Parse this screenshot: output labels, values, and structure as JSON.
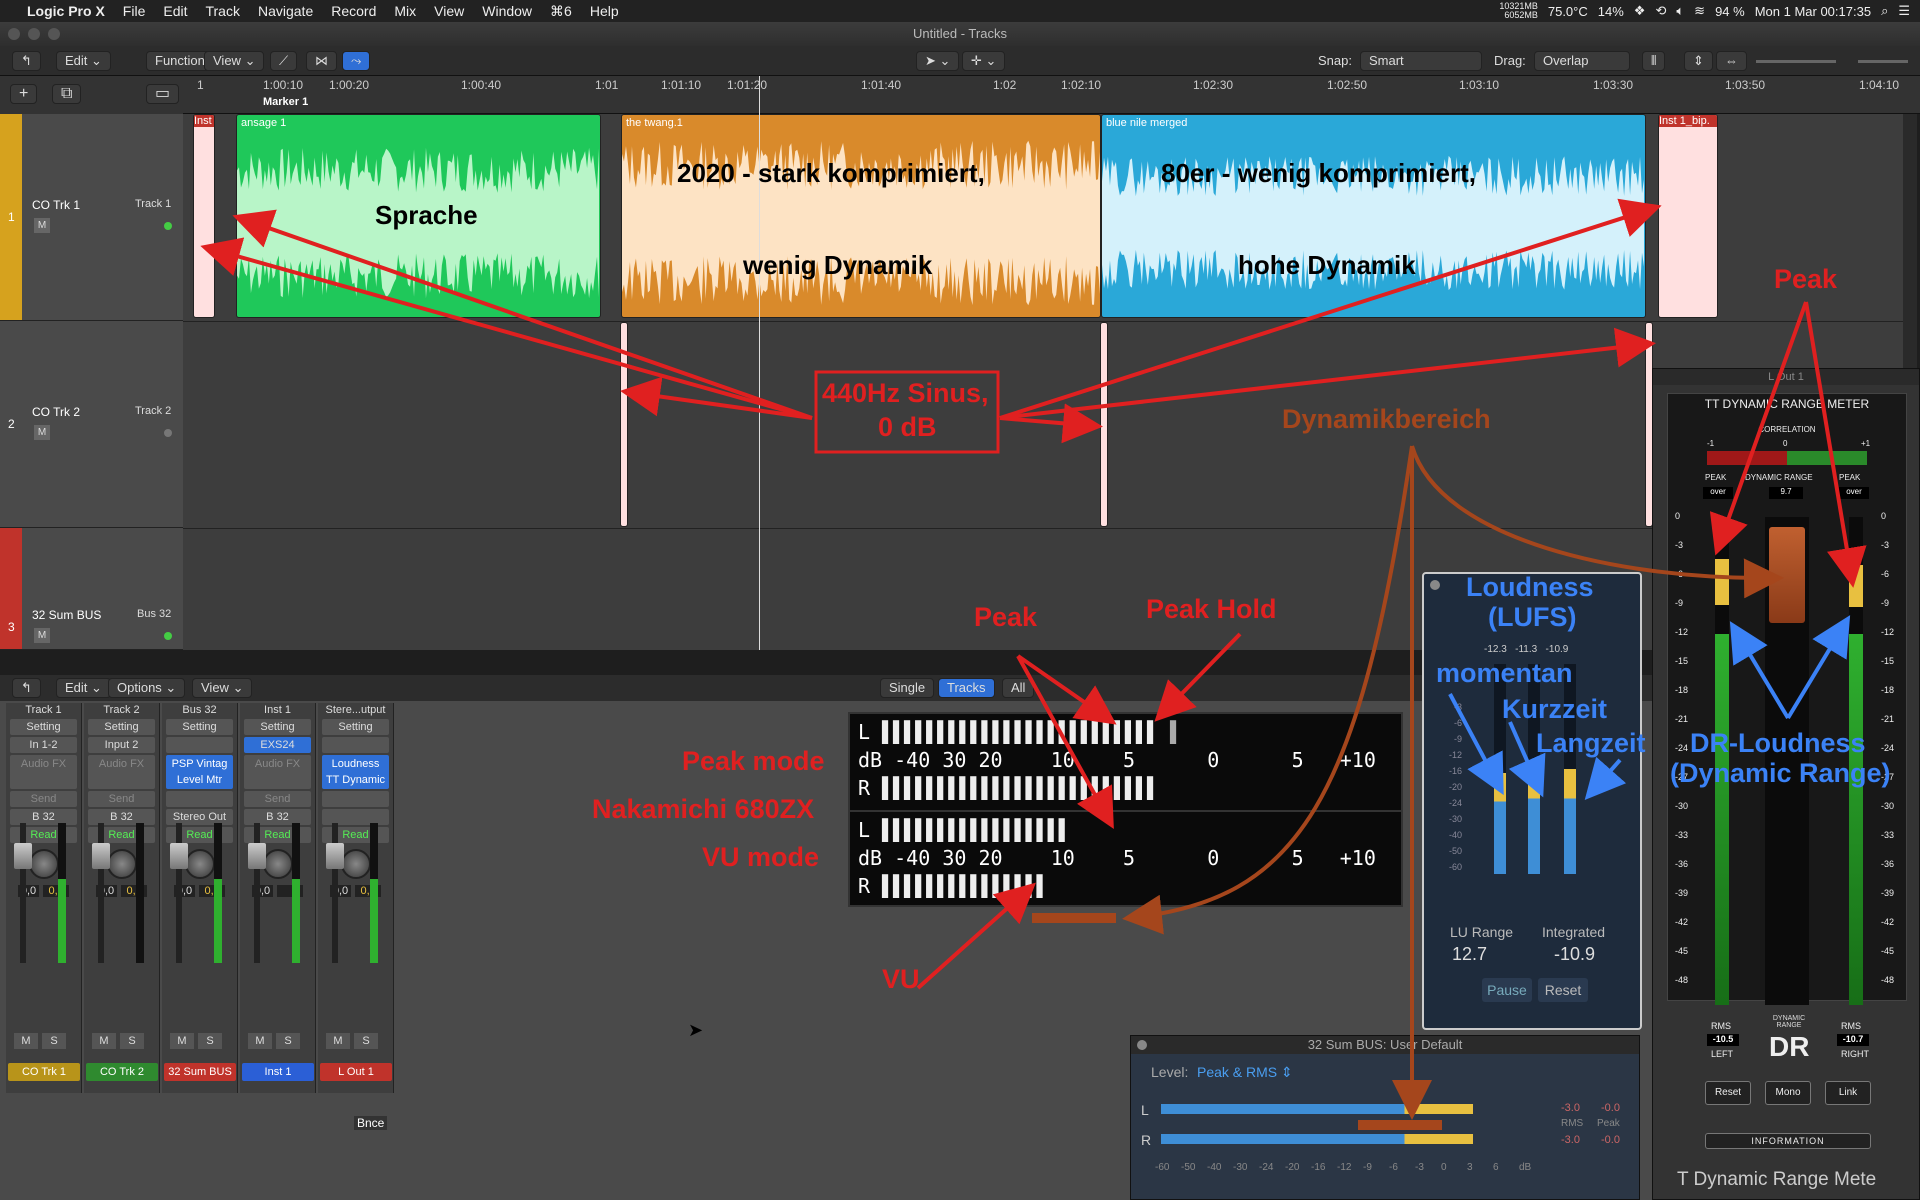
{
  "menubar": {
    "app": "Logic Pro X",
    "items": [
      "File",
      "Edit",
      "Track",
      "Navigate",
      "Record",
      "Mix",
      "View",
      "Window",
      "⌘6",
      "Help"
    ],
    "mem_top": "10321MB",
    "mem_bottom": "6052MB",
    "temp": "75.0°C",
    "cpu": "14%",
    "battery": "94 %",
    "datetime": "Mon 1 Mar 00:17:35"
  },
  "window": {
    "title": "Untitled - Tracks"
  },
  "toolbar": {
    "edit": "Edit",
    "functions": "Functions",
    "view": "View",
    "snap_label": "Snap:",
    "snap_value": "Smart",
    "drag_label": "Drag:",
    "drag_value": "Overlap"
  },
  "ruler": {
    "ticks": [
      "1",
      "1:00:10",
      "1:00:20",
      "1:00:40",
      "1:01",
      "1:01:10",
      "1:01:20",
      "1:01:40",
      "1:02",
      "1:02:10",
      "1:02:30",
      "1:02:50",
      "1:03:10",
      "1:03:30",
      "1:03:50",
      "1:04:10"
    ],
    "marker": "Marker 1"
  },
  "tracks": [
    {
      "num": "1",
      "name": "CO Trk 1",
      "sub": "Track 1",
      "mute": "M",
      "color": "#d6a21e"
    },
    {
      "num": "2",
      "name": "CO Trk 2",
      "sub": "Track 2",
      "mute": "M",
      "color": "#4a4a4a"
    },
    {
      "num": "3",
      "name": "32 Sum BUS",
      "sub": "Bus 32",
      "mute": "M",
      "color": "#c0332b"
    }
  ],
  "regions": {
    "inst_left": "Inst",
    "ansage": "ansage 1",
    "twang": "the twang.1",
    "bluenile": "blue nile merged",
    "inst_right": "Inst 1_bip."
  },
  "annotations": {
    "sprache": "Sprache",
    "komp2020_a": "2020 - stark  komprimiert,",
    "komp2020_b": "wenig  Dynamik",
    "komp80_a": "80er - wenig  komprimiert,",
    "komp80_b": "hohe  Dynamik",
    "sinus_a": "440Hz Sinus,",
    "sinus_b": "0 dB",
    "dynamikbereich": "Dynamikbereich",
    "peak_top": "Peak",
    "peak_mid": "Peak",
    "peak_hold": "Peak Hold",
    "peak_mode": "Peak mode",
    "nakamichi": "Nakamichi 680ZX",
    "vu_mode": "VU mode",
    "vu": "VU",
    "loudness_a": "Loudness",
    "loudness_b": "(LUFS)",
    "momentan": "momentan",
    "kurzzeit": "Kurzzeit",
    "langzeit": "Langzeit",
    "drloud_a": "DR-Loudness",
    "drloud_b": "(Dynamic Range)"
  },
  "mixer": {
    "edit": "Edit",
    "options": "Options",
    "view": "View",
    "tab_single": "Single",
    "tab_tracks": "Tracks",
    "tab_all": "All",
    "strips": [
      {
        "top": "Track 1",
        "setting": "Setting",
        "input": "In 1-2",
        "fx": "Audio FX",
        "fx2": "",
        "send": "Send",
        "out": "B 32",
        "auto": "Read",
        "vol": "0,0",
        "pk": "0,0",
        "name": "CO Trk 1",
        "color": "#b8941a"
      },
      {
        "top": "Track 2",
        "setting": "Setting",
        "input": "Input 2",
        "fx": "Audio FX",
        "fx2": "",
        "send": "Send",
        "out": "B 32",
        "auto": "Read",
        "vol": "0,0",
        "pk": "0,0",
        "name": "CO Trk 2",
        "color": "#2f8a2f"
      },
      {
        "top": "Bus 32",
        "setting": "Setting",
        "input": "",
        "fx": "PSP Vintag",
        "fx2": "Level Mtr",
        "send": "",
        "out": "Stereo Out",
        "auto": "Read",
        "vol": "0,0",
        "pk": "0,0",
        "name": "32 Sum BUS",
        "color": "#c0332b"
      },
      {
        "top": "Inst 1",
        "setting": "Setting",
        "input": "EXS24",
        "fx": "Audio FX",
        "fx2": "",
        "send": "Send",
        "out": "B 32",
        "auto": "Read",
        "vol": "0,0",
        "pk": "",
        "name": "Inst 1",
        "color": "#2b5fd6"
      },
      {
        "top": "Stere...utput",
        "setting": "Setting",
        "input": "",
        "fx": "Loudness",
        "fx2": "TT Dynamic",
        "send": "",
        "out": "",
        "auto": "Read",
        "vol": "0,0",
        "pk": "0,0",
        "name": "L Out 1",
        "color": "#c0332b"
      }
    ],
    "bnce": "Bnce"
  },
  "vu_meter": {
    "row_L": "L",
    "row_dB": "dB",
    "row_R": "R",
    "scale": [
      "-40",
      "30",
      "20",
      "10",
      "5",
      "0",
      "5",
      "+10"
    ]
  },
  "lufs": {
    "top_vals": [
      "-12.3",
      "-11.3",
      "-10.9"
    ],
    "scale": [
      "-3",
      "-6",
      "-9",
      "-12",
      "-16",
      "-20",
      "-24",
      "-30",
      "-40",
      "-50",
      "-60"
    ],
    "lu_range_label": "LU Range",
    "lu_range": "12.7",
    "integrated_label": "Integrated",
    "integrated": "-10.9",
    "pause": "Pause",
    "reset": "Reset",
    "momentary": 0.48,
    "shortterm": 0.5,
    "integrated_level": 0.5
  },
  "drm": {
    "window_title": "L Out 1",
    "title": "TT DYNAMIC RANGE METER",
    "correlation": "CORRELATION",
    "corr_left": "-1",
    "corr_mid": "0",
    "corr_right": "+1",
    "peak_l": "PEAK",
    "dr_label": "DYNAMIC RANGE",
    "peak_r": "PEAK",
    "over_l": "over",
    "dr_value": "9.7",
    "over_r": "over",
    "scale": [
      "0",
      "-3",
      "-6",
      "-9",
      "-12",
      "-15",
      "-18",
      "-21",
      "-24",
      "-27",
      "-30",
      "-33",
      "-36",
      "-39",
      "-42",
      "-45",
      "-48"
    ],
    "rms_l_label": "RMS",
    "rms_l": "-10.5",
    "left": "LEFT",
    "dr_logo": "DR",
    "dr_small": "DYNAMIC RANGE",
    "rms_r_label": "RMS",
    "rms_r": "-10.7",
    "right": "RIGHT",
    "reset": "Reset",
    "mono": "Mono",
    "link": "Link",
    "info": "INFORMATION",
    "footer": "T Dynamic Range Mete"
  },
  "level_meter": {
    "title": "32 Sum BUS: User Default",
    "level_label": "Level:",
    "level_value": "Peak & RMS",
    "l": "L",
    "r": "R",
    "v1": "-3.0",
    "v2": "-0.0",
    "rms": "RMS",
    "peak": "Peak",
    "v3": "-3.0",
    "v4": "-0.0",
    "scale": [
      "-60",
      "-50",
      "-40",
      "-30",
      "-24",
      "-20",
      "-16",
      "-12",
      "-9",
      "-6",
      "-3",
      "0",
      "3",
      "6",
      "dB"
    ]
  }
}
